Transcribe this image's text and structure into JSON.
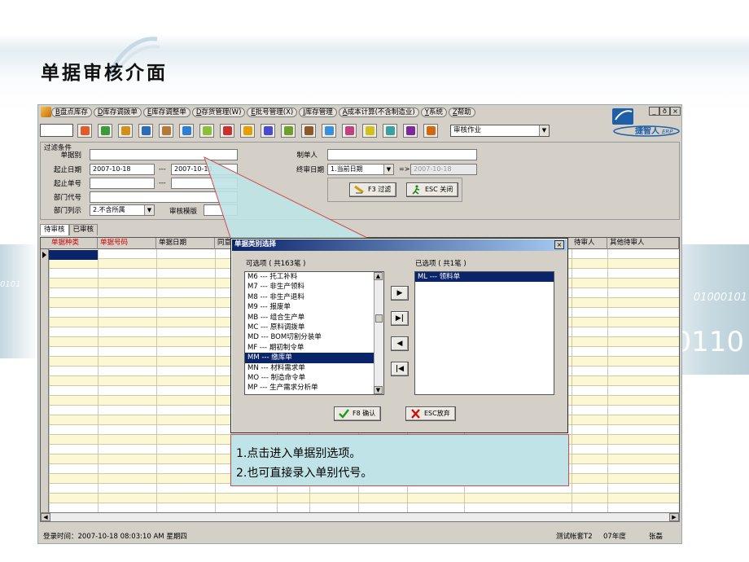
{
  "slide": {
    "title": "单据审核介面"
  },
  "background": {
    "binary_left": "0101",
    "binary_right_small": "01000101",
    "binary_right_large": "0110"
  },
  "app": {
    "menus": [
      {
        "key": "B",
        "label": "盘点库存"
      },
      {
        "key": "D",
        "label": "库存调拨单"
      },
      {
        "key": "E",
        "label": "库存调整单"
      },
      {
        "key": "D",
        "label": "存货管理(W)"
      },
      {
        "key": "E",
        "label": "批号管理(X)"
      },
      {
        "key": "J",
        "label": "库存管理"
      },
      {
        "key": "A",
        "label": "成本计算(不含制造业)"
      },
      {
        "key": "Y",
        "label": "系统"
      },
      {
        "key": "Z",
        "label": "帮助"
      }
    ],
    "window_controls": [
      "_",
      "ð",
      "×"
    ],
    "logo_text": "捷智人",
    "logo_suffix": "ERP",
    "toolbar": {
      "icon_colors": [
        "#e05a2b",
        "#3c9a3c",
        "#d18f1c",
        "#2d6bb8",
        "#b27a3a",
        "#2f7fd0",
        "#8fbf3a",
        "#c93030",
        "#e0a000",
        "#4a4ad0",
        "#6d9e2e",
        "#8a5a2a",
        "#3b8fd8",
        "#c04080",
        "#d0c020",
        "#3aa0a0",
        "#7a2a9a",
        "#d06a10"
      ],
      "selected_mode": "审核作业"
    },
    "filter": {
      "group_title": "过滤条件",
      "doc_type_label": "单据别",
      "date_range_label": "起止日期",
      "date_from": "2007-10-18",
      "date_sep": "---",
      "date_to": "2007-10-18",
      "doc_no_label": "起止单号",
      "doc_no_sep": "---",
      "dept_code_label": "部门代号",
      "dept_list_label": "部门列示",
      "dept_list_value": "2.不含所属",
      "template_label": "审核模版",
      "maker_label": "制单人",
      "final_date_label": "终审日期",
      "final_date_mode": "1.当前日期",
      "final_date_arrow": "=>",
      "final_date_value": "2007-10-18",
      "filter_button": "F3 过滤",
      "close_button": "ESC 关闭"
    },
    "tabs": [
      "待审核",
      "已审核"
    ],
    "grid": {
      "columns": [
        "单据种类",
        "单据号码",
        "单据日期",
        "同意",
        "",
        "",
        "",
        "",
        "",
        "待审人",
        "其他待审人"
      ]
    },
    "status": {
      "login": "登录时间：2007-10-18 08:03:10 AM  星期四",
      "account": "测试帐套T2",
      "year": "07年度",
      "user": "张磊"
    }
  },
  "dialog": {
    "title": "单据类别选择",
    "available_label": "可选项 ( 共163笔 )",
    "selected_label": "已选项 ( 共1笔 )",
    "available_items": [
      "M6 --- 托工补料",
      "M7 --- 非生产领料",
      "M8 --- 非生产退料",
      "M9 --- 报废单",
      "MB --- 组合生产单",
      "MC --- 原料调拨单",
      "MD --- BOM切割分装单",
      "MF --- 期初制令单",
      "MM --- 缴库单",
      "MN --- 材料需求单",
      "MO --- 制造命令单",
      "MP --- 生产需求分析单"
    ],
    "available_selected_index": 8,
    "selected_items": [
      "ML --- 领料单"
    ],
    "move_buttons": [
      "▶",
      "▶|",
      "◀",
      "|◀"
    ],
    "confirm_button": "F8 确认",
    "cancel_button": "ESC放弃"
  },
  "note": {
    "line1": "1.点击进入单据别选项。",
    "line2": "2.也可直接录入单别代号。"
  }
}
